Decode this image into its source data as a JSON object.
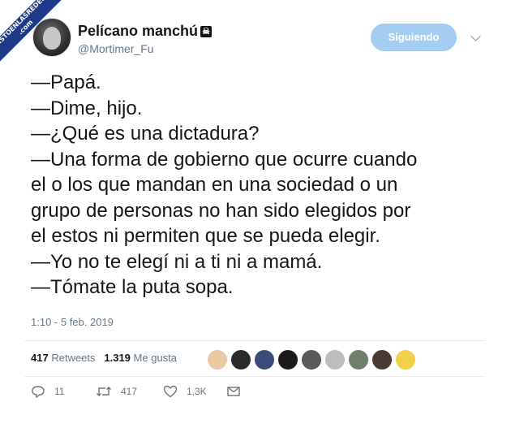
{
  "watermark": {
    "line1": "VISTOENLASREDES",
    "line2": ".com"
  },
  "user": {
    "name": "Pelícano manchú",
    "badge": "☠",
    "handle": "@Mortimer_Fu"
  },
  "follow_button": "Siguiendo",
  "tweet_lines": [
    "—Papá.",
    "—Dime, hijo.",
    "—¿Qué es una dictadura?",
    "—Una forma de gobierno que ocurre cuando",
    "el o los que mandan en una sociedad o un",
    "grupo de personas no han sido elegidos por",
    "el estos ni permiten que se pueda elegir.",
    "—Yo no te elegí ni a ti ni a mamá.",
    "—Tómate la puta sopa."
  ],
  "timestamp": "1:10 - 5 feb. 2019",
  "stats": {
    "retweets_count": "417",
    "retweets_label": "Retweets",
    "likes_count": "1.319",
    "likes_label": "Me gusta"
  },
  "liker_avatar_colors": [
    "#e8c9a0",
    "#2b2b2b",
    "#3a4a7a",
    "#1a1a1a",
    "#5a5a5a",
    "#bdbdbd",
    "#6f7f6a",
    "#4a3a33",
    "#f2d04a"
  ],
  "actions": {
    "replies": "11",
    "retweets": "417",
    "likes": "1,3K"
  },
  "colors": {
    "follow_bg": "#a5cdf2",
    "text": "#14171a",
    "muted": "#657786"
  }
}
